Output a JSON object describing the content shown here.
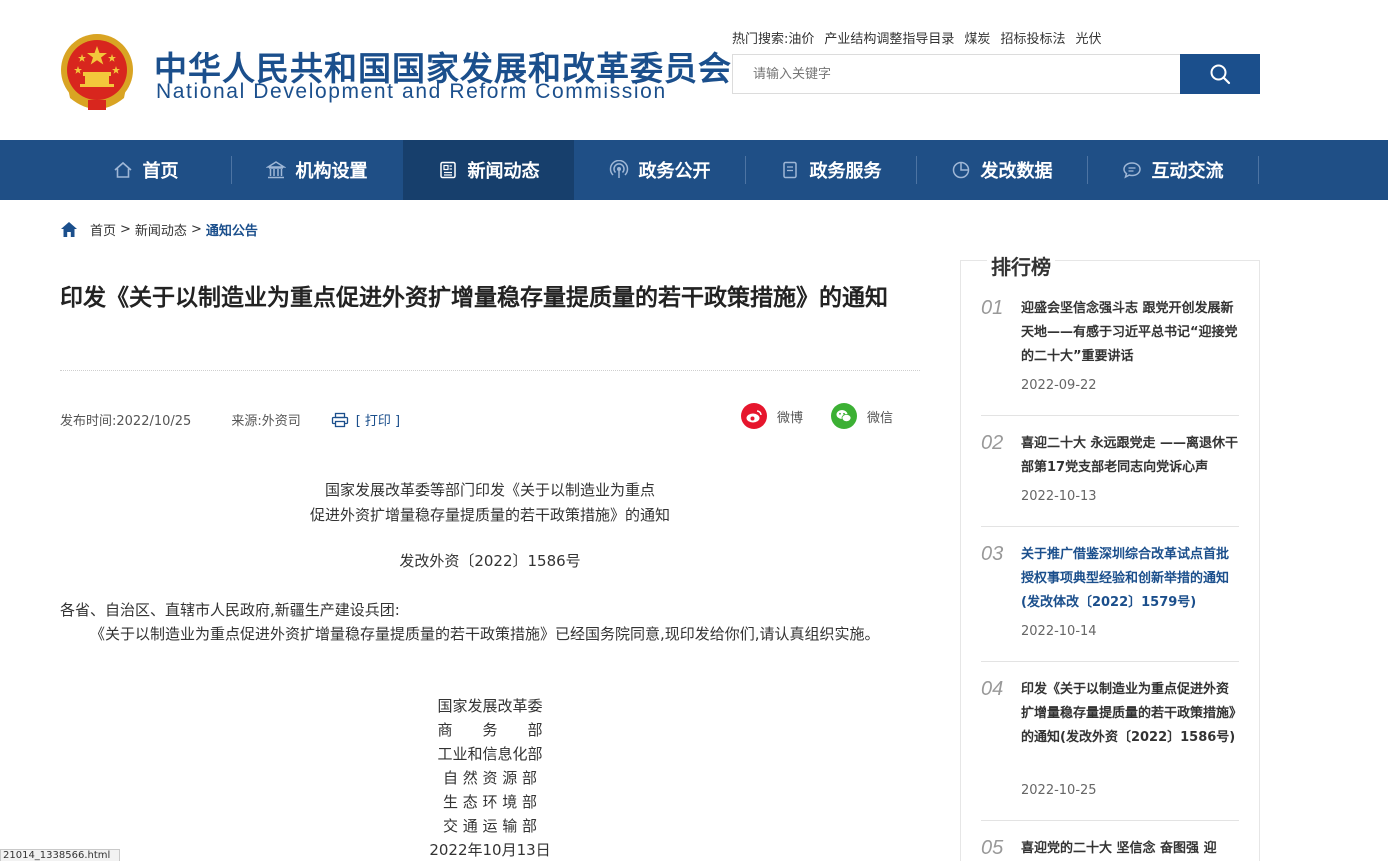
{
  "header": {
    "title_cn": "中华人民共和国国家发展和改革委员会",
    "title_en": "National Development and Reform Commission",
    "hot_label": "热门搜索:",
    "hot_terms": [
      "油价",
      "产业结构调整指导目录",
      "煤炭",
      "招标投标法",
      "光伏"
    ],
    "search_placeholder": "请输入关键字",
    "emblem_icon": "national-emblem-icon"
  },
  "nav": {
    "items": [
      {
        "label": "首页",
        "icon": "home-icon"
      },
      {
        "label": "机构设置",
        "icon": "building-icon"
      },
      {
        "label": "新闻动态",
        "icon": "news-icon",
        "active": true
      },
      {
        "label": "政务公开",
        "icon": "broadcast-icon"
      },
      {
        "label": "政务服务",
        "icon": "document-icon"
      },
      {
        "label": "发改数据",
        "icon": "pie-chart-icon"
      },
      {
        "label": "互动交流",
        "icon": "chat-icon"
      }
    ]
  },
  "breadcrumb": {
    "home": "首页",
    "sep1": ">",
    "news": "新闻动态",
    "sep2": ">",
    "current": "通知公告"
  },
  "article": {
    "title": "印发《关于以制造业为重点促进外资扩增量稳存量提质量的若干政策措施》的通知",
    "publish": "发布时间:2022/10/25",
    "source": "来源:外资司",
    "print": "[ 打印 ]",
    "share_weibo": "微博",
    "share_wechat": "微信",
    "doc_head_1": "国家发展改革委等部门印发《关于以制造业为重点",
    "doc_head_2": "促进外资扩增量稳存量提质量的若干政策措施》的通知",
    "doc_no": "发改外资〔2022〕1586号",
    "addressee": "各省、自治区、直辖市人民政府,新疆生产建设兵团:",
    "body": "《关于以制造业为重点促进外资扩增量稳存量提质量的若干政策措施》已经国务院同意,现印发给你们,请认真组织实施。",
    "signers": [
      "国家发展改革委",
      "商　　务　　部",
      "工业和信息化部",
      "自 然 资 源 部",
      "生 态 环 境 部",
      "交 通 运 输 部"
    ],
    "date": "2022年10月13日"
  },
  "ranking": {
    "title": "排行榜",
    "items": [
      {
        "num": "01",
        "text": "迎盛会坚信念强斗志 跟党开创发展新天地——有感于习近平总书记“迎接党的二十大”重要讲话",
        "date": "2022-09-22"
      },
      {
        "num": "02",
        "text": "喜迎二十大 永远跟党走 ——离退休干部第17党支部老同志向党诉心声",
        "date": "2022-10-13"
      },
      {
        "num": "03",
        "text": "关于推广借鉴深圳综合改革试点首批授权事项典型经验和创新举措的通知(发改体改〔2022〕1579号)",
        "date": "2022-10-14"
      },
      {
        "num": "04",
        "text": "印发《关于以制造业为重点促进外资扩增量稳存量提质量的若干政策措施》的通知(发改外资〔2022〕1586号)",
        "date": "2022-10-25"
      },
      {
        "num": "05",
        "text": "喜迎党的二十大 坚信念 奋图强 迎",
        "date": ""
      }
    ]
  },
  "status_bar": {
    "url_tip": "21014_1338566.html"
  },
  "colors": {
    "brand_blue": "#1b4f8c",
    "nav_bg": "#1f4f86",
    "nav_active": "#173f6c",
    "weibo_red": "#e6162d",
    "wechat_green": "#3cb034"
  }
}
